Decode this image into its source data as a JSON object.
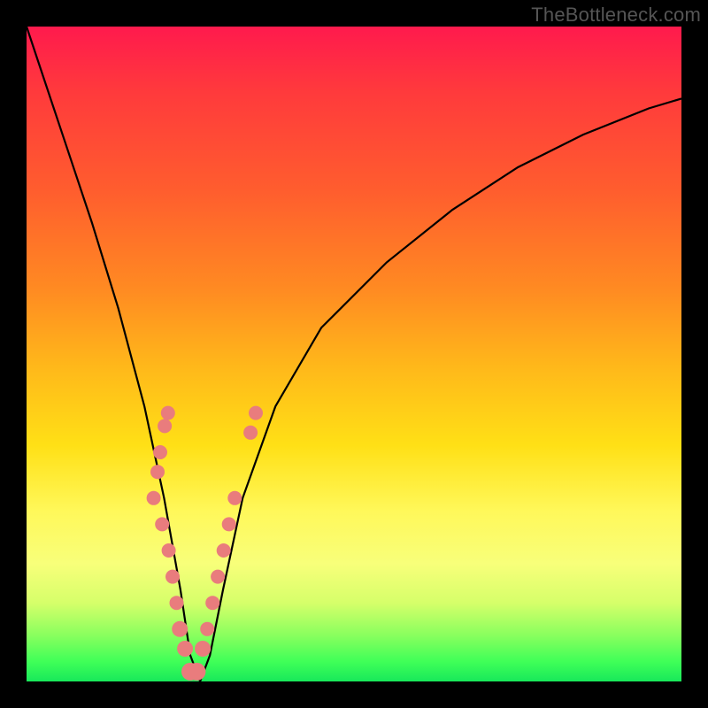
{
  "watermark": "TheBottleneck.com",
  "colors": {
    "frame": "#000000",
    "curve": "#000000",
    "beads": "#e97c7d"
  },
  "chart_data": {
    "type": "line",
    "title": "",
    "xlabel": "",
    "ylabel": "",
    "xlim": [
      0,
      100
    ],
    "ylim": [
      0,
      100
    ],
    "grid": false,
    "legend": false,
    "series": [
      {
        "name": "bottleneck-curve",
        "x": [
          0,
          3,
          6,
          10,
          14,
          18,
          21,
          23.5,
          25,
          26.5,
          28,
          30,
          33,
          38,
          45,
          55,
          65,
          75,
          85,
          95,
          100
        ],
        "y": [
          100,
          91,
          82,
          70,
          57,
          42,
          28,
          14,
          4,
          0,
          4,
          14,
          28,
          42,
          54,
          64,
          72,
          78.5,
          83.5,
          87.5,
          89
        ]
      }
    ],
    "annotations": {
      "beads_left": [
        [
          21.6,
          41
        ],
        [
          21.1,
          39
        ],
        [
          20.4,
          35
        ],
        [
          20.0,
          32
        ],
        [
          19.4,
          28
        ],
        [
          20.7,
          24
        ],
        [
          21.7,
          20
        ],
        [
          22.3,
          16
        ],
        [
          22.9,
          12
        ],
        [
          23.4,
          8
        ],
        [
          24.2,
          5
        ]
      ],
      "beads_right": [
        [
          26.9,
          5
        ],
        [
          27.6,
          8
        ],
        [
          28.4,
          12
        ],
        [
          29.2,
          16
        ],
        [
          30.1,
          20
        ],
        [
          30.9,
          24
        ],
        [
          31.8,
          28
        ],
        [
          34.2,
          38
        ],
        [
          35.0,
          41
        ]
      ]
    }
  }
}
